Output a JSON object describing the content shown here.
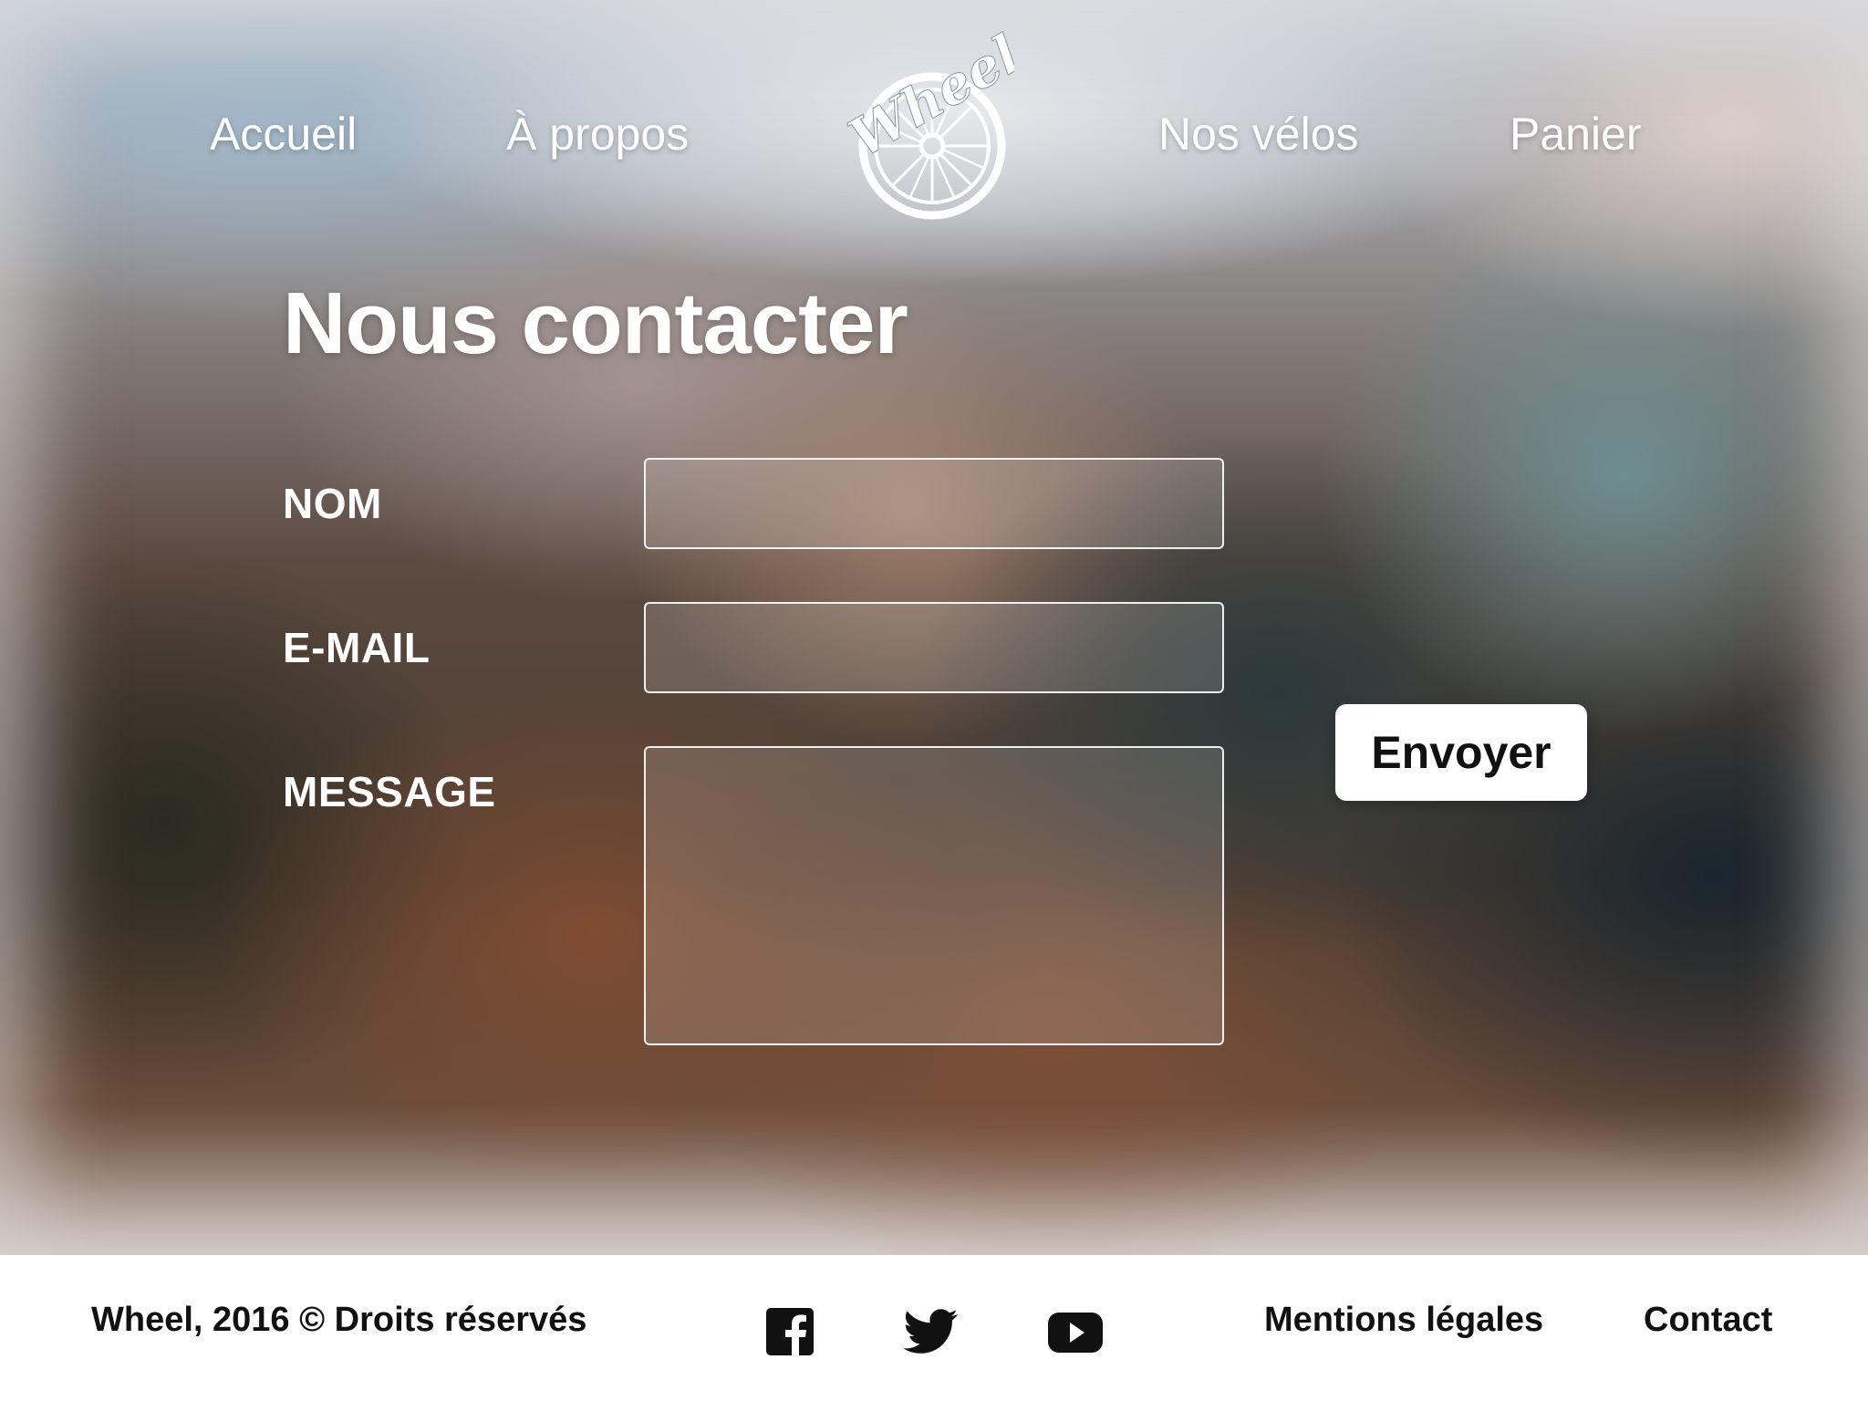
{
  "nav": {
    "left": [
      {
        "label": "Accueil"
      },
      {
        "label": "À propos"
      }
    ],
    "right": [
      {
        "label": "Nos vélos"
      },
      {
        "label": "Panier"
      }
    ],
    "logo_text": "Wheel",
    "logo_icon": "bicycle-wheel-icon"
  },
  "page": {
    "title": "Nous contacter"
  },
  "form": {
    "name_label": "NOM",
    "email_label": "E-MAIL",
    "message_label": "MESSAGE",
    "name_value": "",
    "email_value": "",
    "message_value": "",
    "submit_label": "Envoyer"
  },
  "footer": {
    "copyright": "Wheel, 2016 © Droits réservés",
    "social_icons": [
      "facebook-icon",
      "twitter-icon",
      "youtube-icon"
    ],
    "links": [
      {
        "label": "Mentions légales"
      },
      {
        "label": "Contact"
      }
    ]
  },
  "colors": {
    "text_on_hero": "#ffffff",
    "footer_bg": "#ffffff",
    "footer_text": "#111111",
    "button_bg": "#ffffff"
  }
}
